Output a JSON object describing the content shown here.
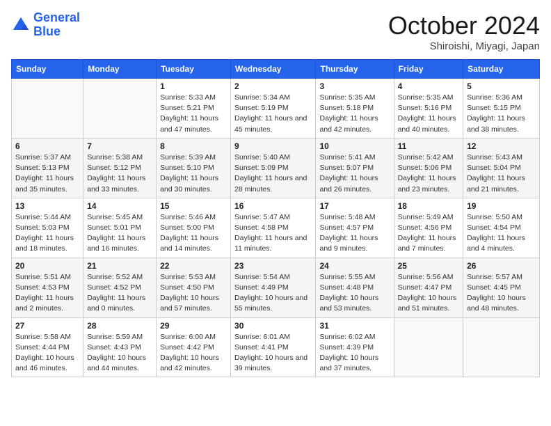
{
  "header": {
    "logo_line1": "General",
    "logo_line2": "Blue",
    "title": "October 2024",
    "subtitle": "Shiroishi, Miyagi, Japan"
  },
  "columns": [
    "Sunday",
    "Monday",
    "Tuesday",
    "Wednesday",
    "Thursday",
    "Friday",
    "Saturday"
  ],
  "weeks": [
    [
      {
        "day": "",
        "info": ""
      },
      {
        "day": "",
        "info": ""
      },
      {
        "day": "1",
        "info": "Sunrise: 5:33 AM\nSunset: 5:21 PM\nDaylight: 11 hours and 47 minutes."
      },
      {
        "day": "2",
        "info": "Sunrise: 5:34 AM\nSunset: 5:19 PM\nDaylight: 11 hours and 45 minutes."
      },
      {
        "day": "3",
        "info": "Sunrise: 5:35 AM\nSunset: 5:18 PM\nDaylight: 11 hours and 42 minutes."
      },
      {
        "day": "4",
        "info": "Sunrise: 5:35 AM\nSunset: 5:16 PM\nDaylight: 11 hours and 40 minutes."
      },
      {
        "day": "5",
        "info": "Sunrise: 5:36 AM\nSunset: 5:15 PM\nDaylight: 11 hours and 38 minutes."
      }
    ],
    [
      {
        "day": "6",
        "info": "Sunrise: 5:37 AM\nSunset: 5:13 PM\nDaylight: 11 hours and 35 minutes."
      },
      {
        "day": "7",
        "info": "Sunrise: 5:38 AM\nSunset: 5:12 PM\nDaylight: 11 hours and 33 minutes."
      },
      {
        "day": "8",
        "info": "Sunrise: 5:39 AM\nSunset: 5:10 PM\nDaylight: 11 hours and 30 minutes."
      },
      {
        "day": "9",
        "info": "Sunrise: 5:40 AM\nSunset: 5:09 PM\nDaylight: 11 hours and 28 minutes."
      },
      {
        "day": "10",
        "info": "Sunrise: 5:41 AM\nSunset: 5:07 PM\nDaylight: 11 hours and 26 minutes."
      },
      {
        "day": "11",
        "info": "Sunrise: 5:42 AM\nSunset: 5:06 PM\nDaylight: 11 hours and 23 minutes."
      },
      {
        "day": "12",
        "info": "Sunrise: 5:43 AM\nSunset: 5:04 PM\nDaylight: 11 hours and 21 minutes."
      }
    ],
    [
      {
        "day": "13",
        "info": "Sunrise: 5:44 AM\nSunset: 5:03 PM\nDaylight: 11 hours and 18 minutes."
      },
      {
        "day": "14",
        "info": "Sunrise: 5:45 AM\nSunset: 5:01 PM\nDaylight: 11 hours and 16 minutes."
      },
      {
        "day": "15",
        "info": "Sunrise: 5:46 AM\nSunset: 5:00 PM\nDaylight: 11 hours and 14 minutes."
      },
      {
        "day": "16",
        "info": "Sunrise: 5:47 AM\nSunset: 4:58 PM\nDaylight: 11 hours and 11 minutes."
      },
      {
        "day": "17",
        "info": "Sunrise: 5:48 AM\nSunset: 4:57 PM\nDaylight: 11 hours and 9 minutes."
      },
      {
        "day": "18",
        "info": "Sunrise: 5:49 AM\nSunset: 4:56 PM\nDaylight: 11 hours and 7 minutes."
      },
      {
        "day": "19",
        "info": "Sunrise: 5:50 AM\nSunset: 4:54 PM\nDaylight: 11 hours and 4 minutes."
      }
    ],
    [
      {
        "day": "20",
        "info": "Sunrise: 5:51 AM\nSunset: 4:53 PM\nDaylight: 11 hours and 2 minutes."
      },
      {
        "day": "21",
        "info": "Sunrise: 5:52 AM\nSunset: 4:52 PM\nDaylight: 11 hours and 0 minutes."
      },
      {
        "day": "22",
        "info": "Sunrise: 5:53 AM\nSunset: 4:50 PM\nDaylight: 10 hours and 57 minutes."
      },
      {
        "day": "23",
        "info": "Sunrise: 5:54 AM\nSunset: 4:49 PM\nDaylight: 10 hours and 55 minutes."
      },
      {
        "day": "24",
        "info": "Sunrise: 5:55 AM\nSunset: 4:48 PM\nDaylight: 10 hours and 53 minutes."
      },
      {
        "day": "25",
        "info": "Sunrise: 5:56 AM\nSunset: 4:47 PM\nDaylight: 10 hours and 51 minutes."
      },
      {
        "day": "26",
        "info": "Sunrise: 5:57 AM\nSunset: 4:45 PM\nDaylight: 10 hours and 48 minutes."
      }
    ],
    [
      {
        "day": "27",
        "info": "Sunrise: 5:58 AM\nSunset: 4:44 PM\nDaylight: 10 hours and 46 minutes."
      },
      {
        "day": "28",
        "info": "Sunrise: 5:59 AM\nSunset: 4:43 PM\nDaylight: 10 hours and 44 minutes."
      },
      {
        "day": "29",
        "info": "Sunrise: 6:00 AM\nSunset: 4:42 PM\nDaylight: 10 hours and 42 minutes."
      },
      {
        "day": "30",
        "info": "Sunrise: 6:01 AM\nSunset: 4:41 PM\nDaylight: 10 hours and 39 minutes."
      },
      {
        "day": "31",
        "info": "Sunrise: 6:02 AM\nSunset: 4:39 PM\nDaylight: 10 hours and 37 minutes."
      },
      {
        "day": "",
        "info": ""
      },
      {
        "day": "",
        "info": ""
      }
    ]
  ]
}
